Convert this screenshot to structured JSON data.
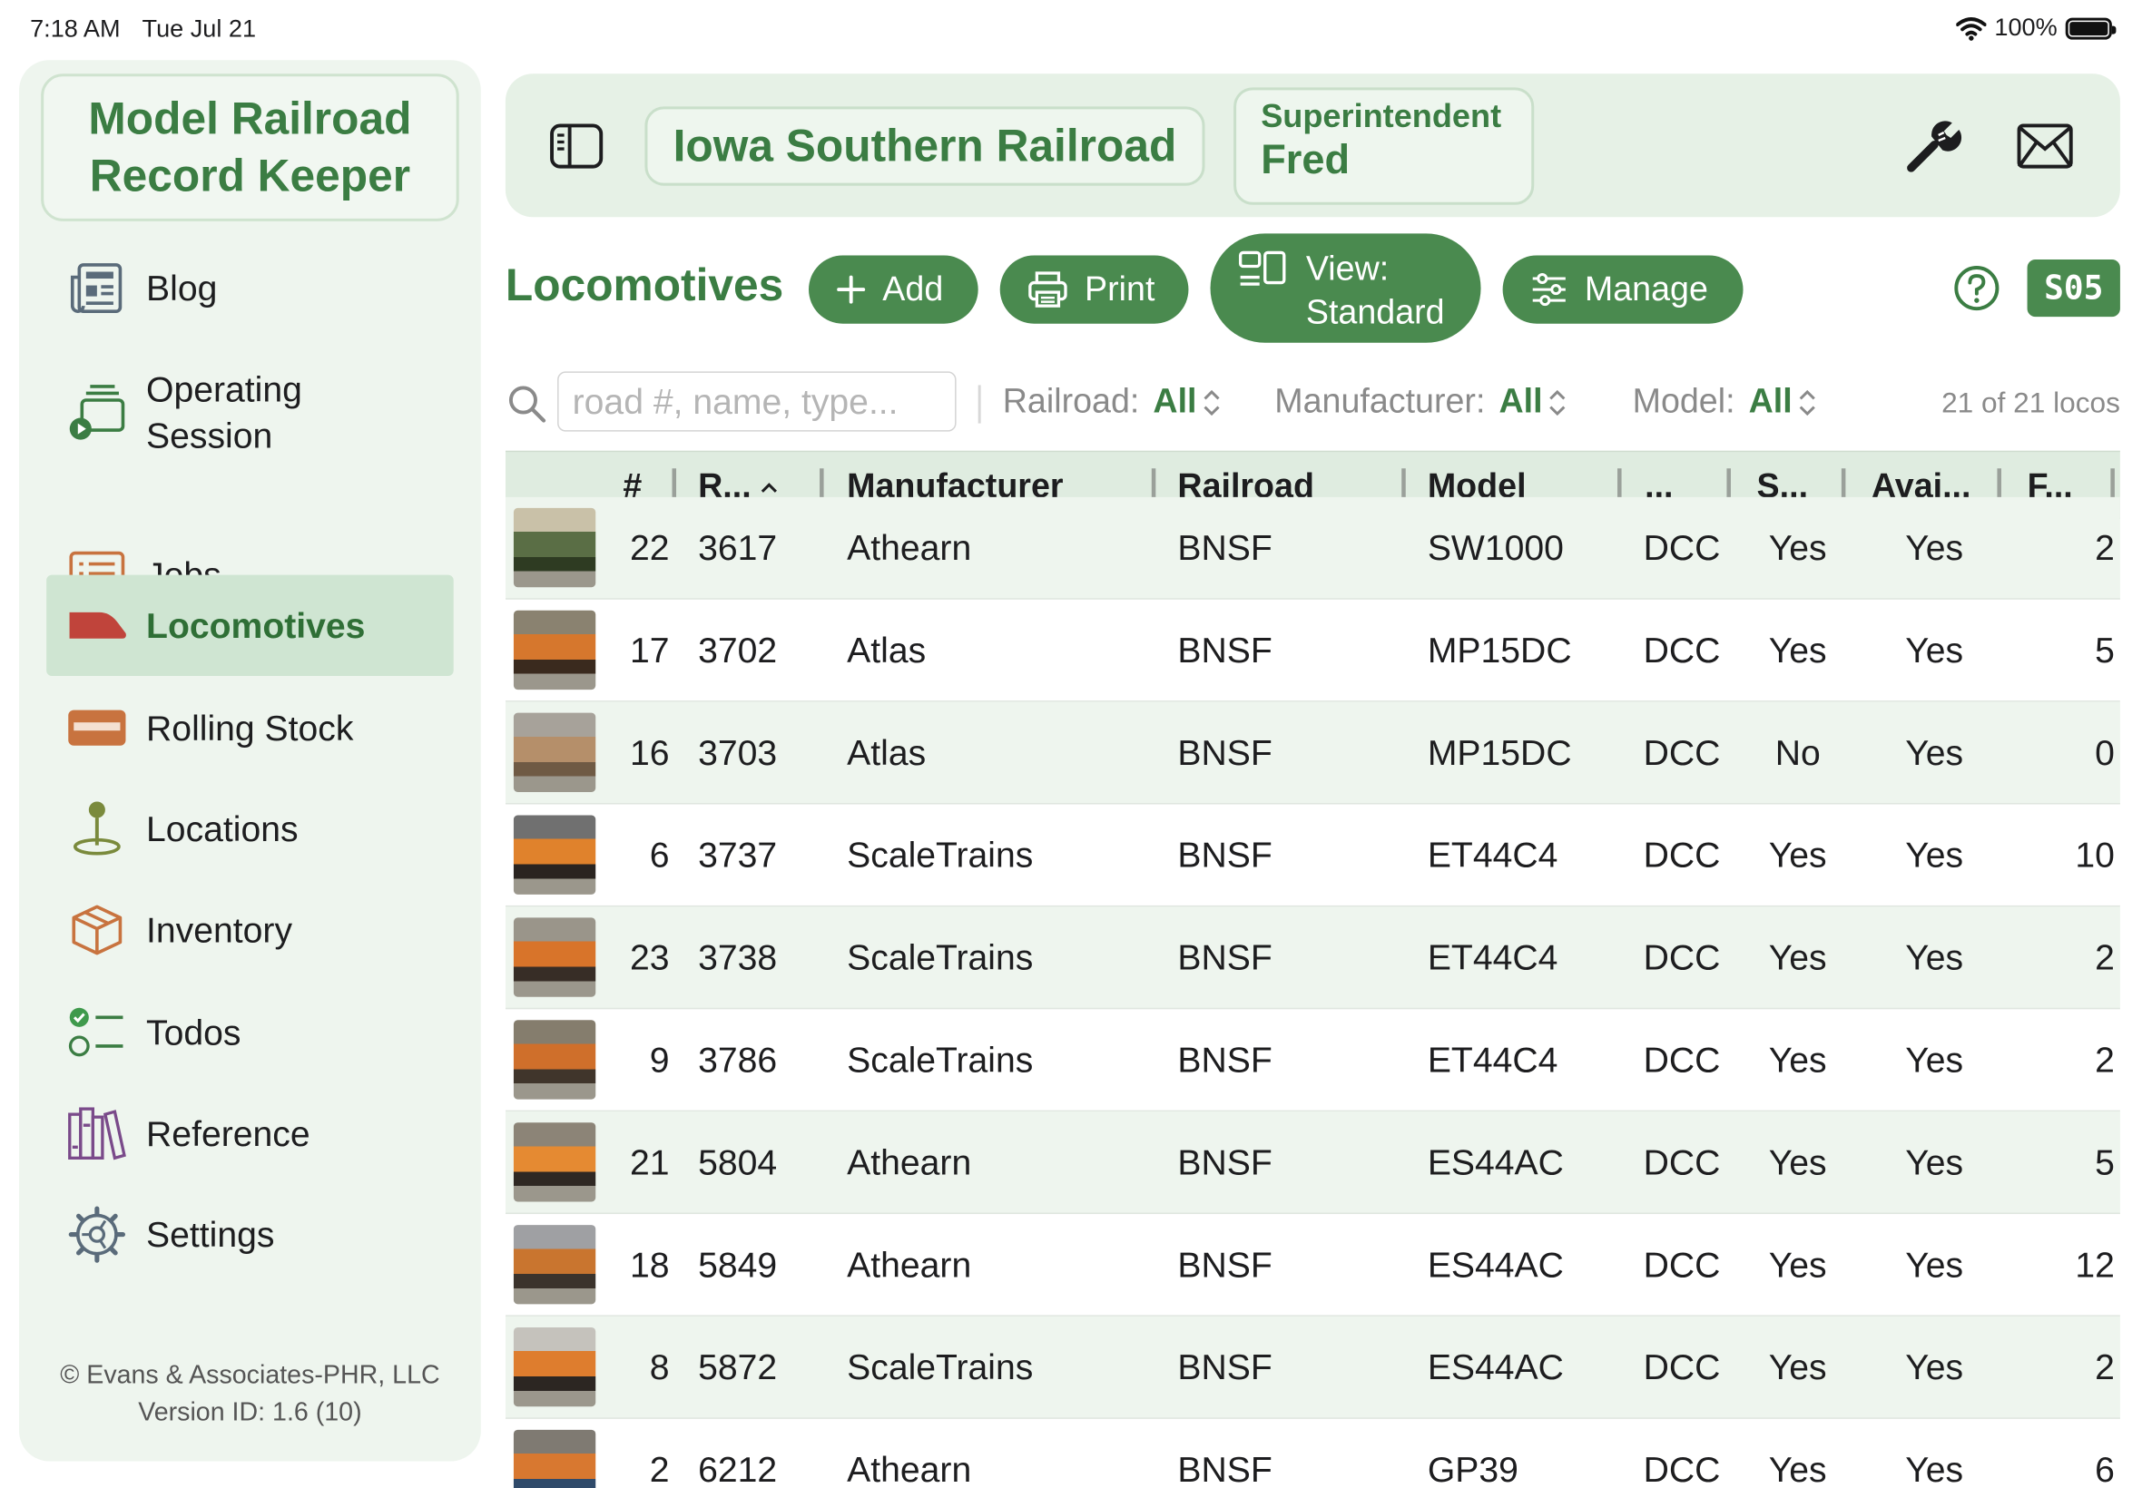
{
  "status_bar": {
    "time": "7:18 AM",
    "date": "Tue Jul 21",
    "battery": "100%"
  },
  "sidebar": {
    "app_title": "Model Railroad\nRecord Keeper",
    "items": [
      {
        "label": "Blog",
        "icon": "newspaper-icon",
        "selected": false
      },
      {
        "label": "Operating\nSession",
        "icon": "operating-session-icon",
        "selected": false
      },
      {
        "label": "Jobs",
        "icon": "list-icon",
        "selected": false
      },
      {
        "label": "Locomotives",
        "icon": "locomotive-icon",
        "selected": true
      },
      {
        "label": "Rolling Stock",
        "icon": "rolling-stock-icon",
        "selected": false
      },
      {
        "label": "Locations",
        "icon": "location-pin-icon",
        "selected": false
      },
      {
        "label": "Inventory",
        "icon": "box-icon",
        "selected": false
      },
      {
        "label": "Todos",
        "icon": "checklist-icon",
        "selected": false
      },
      {
        "label": "Reference",
        "icon": "books-icon",
        "selected": false
      },
      {
        "label": "Settings",
        "icon": "gear-icon",
        "selected": false
      }
    ],
    "copyright": "© Evans & Associates-PHR, LLC",
    "version": "Version ID: 1.6 (10)"
  },
  "header": {
    "railroad": "Iowa Southern Railroad",
    "role": "Superintendent",
    "user": "Fred"
  },
  "toolbar": {
    "title": "Locomotives",
    "add_label": "Add",
    "print_label": "Print",
    "view_label": "View:\nStandard",
    "manage_label": "Manage",
    "badge": "S05"
  },
  "filters": {
    "search_placeholder": "road #, name, type...",
    "railroad_label": "Railroad:",
    "railroad_value": "All",
    "manufacturer_label": "Manufacturer:",
    "manufacturer_value": "All",
    "model_label": "Model:",
    "model_value": "All",
    "count": "21 of 21 locos"
  },
  "table": {
    "columns": [
      "#",
      "R...",
      "Manufacturer",
      "Railroad",
      "Model",
      "...",
      "S...",
      "Avai...",
      "F..."
    ],
    "sort_column": "R...",
    "rows": [
      {
        "num": "22",
        "road": "3617",
        "manufacturer": "Athearn",
        "railroad": "BNSF",
        "model": "SW1000",
        "control": "DCC",
        "sound": "Yes",
        "available": "Yes",
        "f": "2"
      },
      {
        "num": "17",
        "road": "3702",
        "manufacturer": "Atlas",
        "railroad": "BNSF",
        "model": "MP15DC",
        "control": "DCC",
        "sound": "Yes",
        "available": "Yes",
        "f": "5"
      },
      {
        "num": "16",
        "road": "3703",
        "manufacturer": "Atlas",
        "railroad": "BNSF",
        "model": "MP15DC",
        "control": "DCC",
        "sound": "No",
        "available": "Yes",
        "f": "0"
      },
      {
        "num": "6",
        "road": "3737",
        "manufacturer": "ScaleTrains",
        "railroad": "BNSF",
        "model": "ET44C4",
        "control": "DCC",
        "sound": "Yes",
        "available": "Yes",
        "f": "10"
      },
      {
        "num": "23",
        "road": "3738",
        "manufacturer": "ScaleTrains",
        "railroad": "BNSF",
        "model": "ET44C4",
        "control": "DCC",
        "sound": "Yes",
        "available": "Yes",
        "f": "2"
      },
      {
        "num": "9",
        "road": "3786",
        "manufacturer": "ScaleTrains",
        "railroad": "BNSF",
        "model": "ET44C4",
        "control": "DCC",
        "sound": "Yes",
        "available": "Yes",
        "f": "2"
      },
      {
        "num": "21",
        "road": "5804",
        "manufacturer": "Athearn",
        "railroad": "BNSF",
        "model": "ES44AC",
        "control": "DCC",
        "sound": "Yes",
        "available": "Yes",
        "f": "5"
      },
      {
        "num": "18",
        "road": "5849",
        "manufacturer": "Athearn",
        "railroad": "BNSF",
        "model": "ES44AC",
        "control": "DCC",
        "sound": "Yes",
        "available": "Yes",
        "f": "12"
      },
      {
        "num": "8",
        "road": "5872",
        "manufacturer": "ScaleTrains",
        "railroad": "BNSF",
        "model": "ES44AC",
        "control": "DCC",
        "sound": "Yes",
        "available": "Yes",
        "f": "2"
      },
      {
        "num": "2",
        "road": "6212",
        "manufacturer": "Athearn",
        "railroad": "BNSF",
        "model": "GP39",
        "control": "DCC",
        "sound": "Yes",
        "available": "Yes",
        "f": "6"
      }
    ]
  },
  "colors": {
    "accent": "#4a8a4f",
    "title_green": "#3b7d43",
    "sidebar_bg": "#eef5ee",
    "selected_bg": "#cfe5d2",
    "locomotive_red": "#c0443b",
    "rolling_stock_orange": "#c8733f"
  }
}
